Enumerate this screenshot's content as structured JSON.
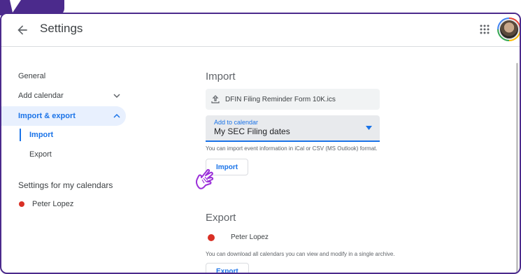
{
  "header": {
    "title": "Settings",
    "back_icon": "arrow-left-icon",
    "apps_icon": "apps-grid-icon",
    "avatar_icon": "user-avatar"
  },
  "sidebar": {
    "items": [
      {
        "label": "General"
      },
      {
        "label": "Add calendar"
      },
      {
        "label": "Import & export"
      }
    ],
    "sub_items": [
      {
        "label": "Import"
      },
      {
        "label": "Export"
      }
    ],
    "section_label": "Settings for my calendars",
    "calendars": [
      {
        "name": "Peter Lopez",
        "color": "#d93025"
      }
    ]
  },
  "import": {
    "heading": "Import",
    "file_name": "DFIN Filing Reminder Form 10K.ics",
    "select_label": "Add to calendar",
    "select_value": "My SEC Filing dates",
    "hint": "You can import event information in iCal or CSV (MS Outlook) format.",
    "button_label": "Import"
  },
  "export": {
    "heading": "Export",
    "calendar_name": "Peter Lopez",
    "hint": "You can download all calendars you can view and modify in a single archive.",
    "button_label": "Export"
  },
  "colors": {
    "accent": "#1a73e8",
    "frame": "#4b2a8c",
    "calendar_red": "#d93025",
    "cursor": "#9b30d9"
  }
}
